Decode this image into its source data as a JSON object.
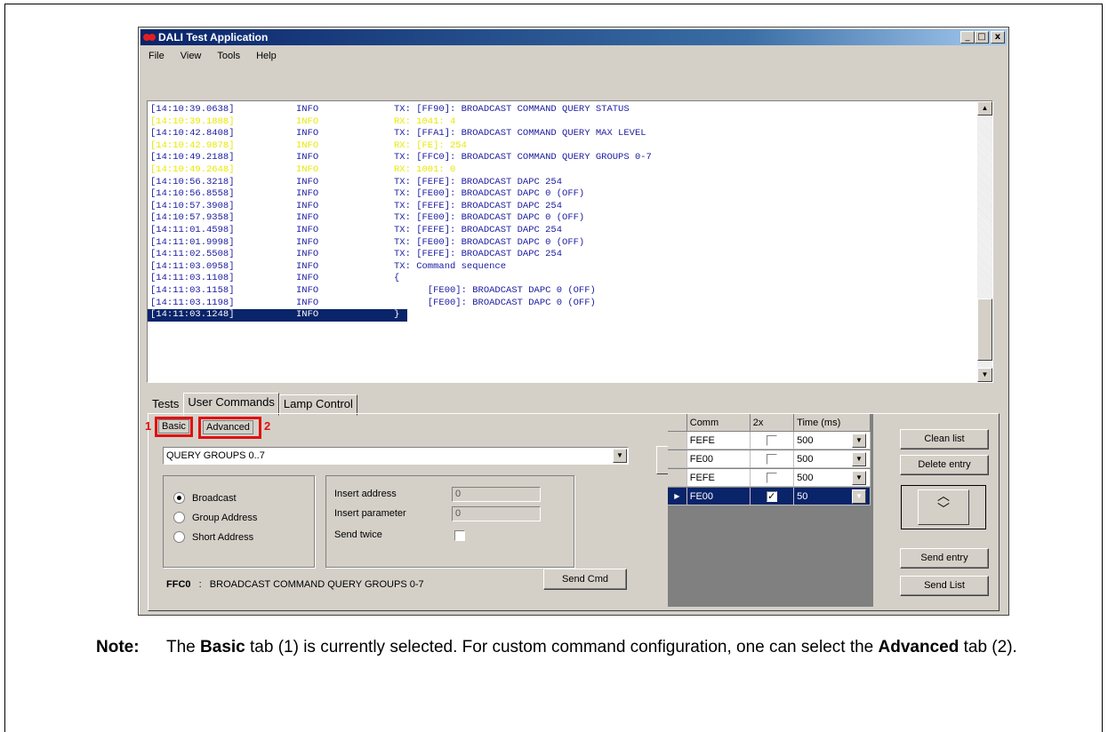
{
  "window": {
    "title": "DALI Test Application",
    "controls": [
      "_",
      "□",
      "x"
    ]
  },
  "menu": [
    "File",
    "View",
    "Tools",
    "Help"
  ],
  "log": [
    {
      "time": "[14:10:39.0638]",
      "level": "INFO",
      "msg": "TX: [FF90]: BROADCAST COMMAND QUERY STATUS",
      "kind": "tx"
    },
    {
      "time": "[14:10:39.1888]",
      "level": "INFO",
      "msg": "RX: 1041: 4",
      "kind": "rx"
    },
    {
      "time": "[14:10:42.8408]",
      "level": "INFO",
      "msg": "TX: [FFA1]: BROADCAST COMMAND QUERY MAX LEVEL",
      "kind": "tx"
    },
    {
      "time": "[14:10:42.9878]",
      "level": "INFO",
      "msg": "RX: [FE]: 254",
      "kind": "rx"
    },
    {
      "time": "[14:10:49.2188]",
      "level": "INFO",
      "msg": "TX: [FFC0]: BROADCAST COMMAND QUERY GROUPS 0-7",
      "kind": "tx"
    },
    {
      "time": "[14:10:49.2648]",
      "level": "INFO",
      "msg": "RX: 1001: 0",
      "kind": "rx"
    },
    {
      "time": "[14:10:56.3218]",
      "level": "INFO",
      "msg": "TX: [FEFE]: BROADCAST DAPC 254",
      "kind": "tx"
    },
    {
      "time": "[14:10:56.8558]",
      "level": "INFO",
      "msg": "TX: [FE00]: BROADCAST DAPC 0 (OFF)",
      "kind": "tx"
    },
    {
      "time": "[14:10:57.3908]",
      "level": "INFO",
      "msg": "TX: [FEFE]: BROADCAST DAPC 254",
      "kind": "tx"
    },
    {
      "time": "[14:10:57.9358]",
      "level": "INFO",
      "msg": "TX: [FE00]: BROADCAST DAPC 0 (OFF)",
      "kind": "tx"
    },
    {
      "time": "[14:11:01.4598]",
      "level": "INFO",
      "msg": "TX: [FEFE]: BROADCAST DAPC 254",
      "kind": "tx"
    },
    {
      "time": "[14:11:01.9998]",
      "level": "INFO",
      "msg": "TX: [FE00]: BROADCAST DAPC 0 (OFF)",
      "kind": "tx"
    },
    {
      "time": "[14:11:02.5508]",
      "level": "INFO",
      "msg": "TX: [FEFE]: BROADCAST DAPC 254",
      "kind": "tx"
    },
    {
      "time": "[14:11:03.0958]",
      "level": "INFO",
      "msg": "TX: Command sequence",
      "kind": "tx"
    },
    {
      "time": "[14:11:03.1108]",
      "level": "INFO",
      "msg": "{",
      "kind": "tx"
    },
    {
      "time": "[14:11:03.1158]",
      "level": "INFO",
      "msg": "      [FE00]: BROADCAST DAPC 0 (OFF)",
      "kind": "tx"
    },
    {
      "time": "[14:11:03.1198]",
      "level": "INFO",
      "msg": "      [FE00]: BROADCAST DAPC 0 (OFF)",
      "kind": "tx"
    },
    {
      "time": "[14:11:03.1248]",
      "level": "INFO",
      "msg": "}",
      "kind": "sel"
    }
  ],
  "tabs": [
    "Tests",
    "User Commands",
    "Lamp Control"
  ],
  "subtabs": {
    "basic": "Basic",
    "advanced": "Advanced",
    "marker1": "1",
    "marker2": "2"
  },
  "command_select": {
    "value": "QUERY GROUPS 0..7",
    "arrow": "›"
  },
  "address_mode": {
    "options": [
      "Broadcast",
      "Group Address",
      "Short Address"
    ],
    "selected": "Broadcast"
  },
  "fields": {
    "insert_address_label": "Insert address",
    "insert_address_value": "0",
    "insert_parameter_label": "Insert parameter",
    "insert_parameter_value": "0",
    "send_twice_label": "Send twice"
  },
  "info": {
    "code": "FFC0",
    "sep": ":",
    "desc": "BROADCAST COMMAND QUERY GROUPS 0-7"
  },
  "buttons": {
    "send_cmd": "Send Cmd",
    "clean_list": "Clean list",
    "delete_entry": "Delete entry",
    "send_entry": "Send entry",
    "send_list": "Send List"
  },
  "grid": {
    "headers": [
      "Comm",
      "2x",
      "Time (ms)"
    ],
    "rows": [
      {
        "comm": "FEFE",
        "twice": false,
        "time": "500"
      },
      {
        "comm": "FE00",
        "twice": false,
        "time": "500"
      },
      {
        "comm": "FEFE",
        "twice": false,
        "time": "500"
      },
      {
        "comm": "FE00",
        "twice": true,
        "time": "50",
        "selected": true
      }
    ]
  },
  "note": {
    "label": "Note:",
    "p1": "The ",
    "b1": "Basic",
    "p2": " tab (1) is currently selected. For custom command configuration, one can select the ",
    "b2": "Advanced",
    "p3": " tab (2)."
  },
  "colors": {
    "tx": "#1a1aa0",
    "rx": "#e8e800",
    "selection": "#0a246a",
    "highlight": "#e01010"
  }
}
